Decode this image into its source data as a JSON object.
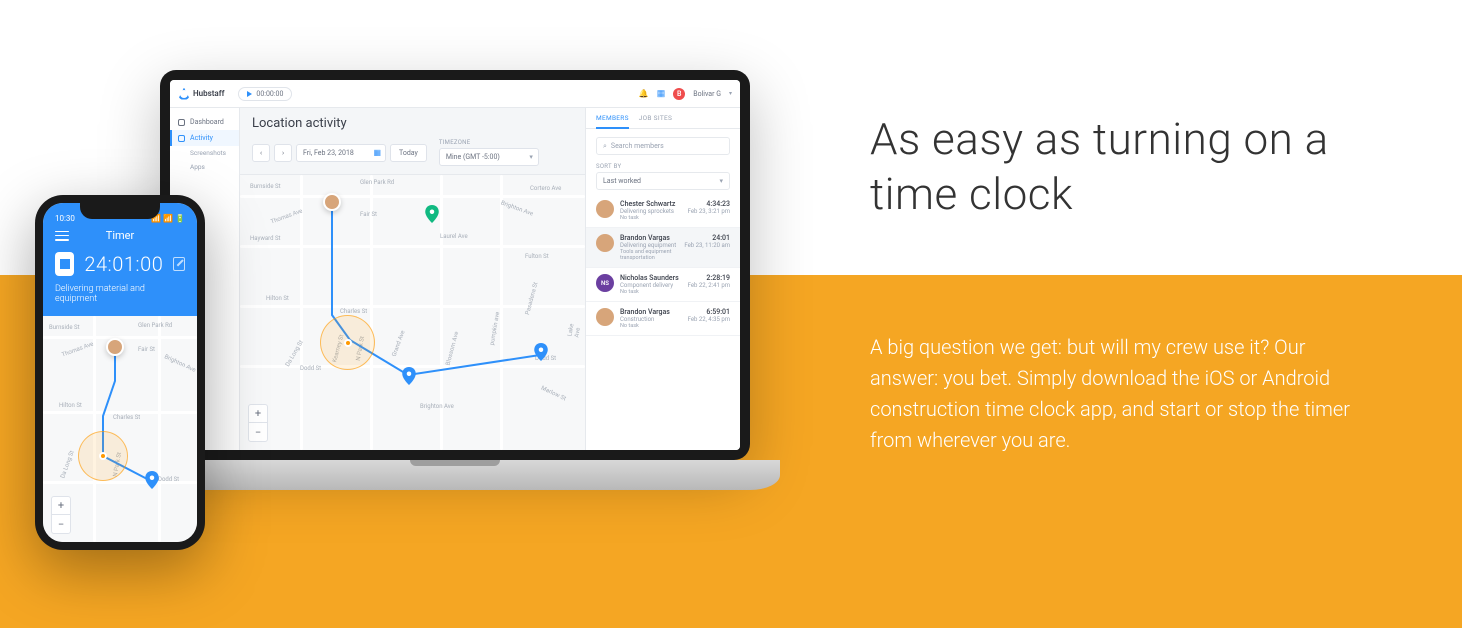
{
  "marketing": {
    "headline": "As easy as turning on a time clock",
    "description": "A big question we get: but will my crew use it? Our answer: you bet. Simply download the iOS or Android construction time clock app, and start or stop the timer from wherever you are."
  },
  "laptop": {
    "brand": "Hubstaff",
    "timer_pill": "00:00:00",
    "user_name": "Bolivar G",
    "user_initial": "B",
    "sidebar": {
      "dashboard": "Dashboard",
      "activity": "Activity",
      "screenshots": "Screenshots",
      "apps": "Apps"
    },
    "page_title": "Location activity",
    "date": "Fri, Feb 23, 2018",
    "today": "Today",
    "timezone_label": "TIMEZONE",
    "timezone_value": "Mine (GMT -5:00)",
    "panel": {
      "tab_members": "MEMBERS",
      "tab_jobsites": "JOB SITES",
      "search_placeholder": "Search members",
      "sortby_label": "SORT BY",
      "sortby_value": "Last worked",
      "members": [
        {
          "name": "Chester Schwartz",
          "task": "Delivering sprockets",
          "task2": "No task",
          "time": "4:34:23",
          "when": "Feb 23, 3:21 pm"
        },
        {
          "name": "Brandon Vargas",
          "task": "Delivering equipment",
          "task2": "Tools and equipment transportation",
          "time": "24:01",
          "when": "Feb 23, 11:20 am"
        },
        {
          "name": "Nicholas Saunders",
          "task": "Component delivery",
          "task2": "No task",
          "time": "2:28:19",
          "when": "Feb 22, 2:41 pm",
          "initial": "NS"
        },
        {
          "name": "Brandon Vargas",
          "task": "Construction",
          "task2": "No task",
          "time": "6:59:01",
          "when": "Feb 22, 4:35 pm"
        }
      ]
    },
    "streets": {
      "burnside": "Burnside St",
      "glenpark": "Glen Park Rd",
      "thomas": "Thomas Ave",
      "fair": "Fair St",
      "brighton": "Brighton Ave",
      "hayward": "Hayward St",
      "laurel": "Laurel Ave",
      "cortero": "Cortero Ave",
      "fulton": "Fulton St",
      "hilton": "Hilton St",
      "charles": "Charles St",
      "dodd": "Dodd St",
      "dodd2": "Dodd St",
      "kearney": "Kearney St",
      "npark": "N Park St",
      "grand": "Grand Ave",
      "blossom": "Blossom Ave",
      "pumpkin": "pumpkin ave",
      "lake": "Lake Ave",
      "brighton2": "Brighton Ave",
      "pasadena": "Pasadena St",
      "marlow": "Marlow St",
      "dalong": "Da Long St"
    }
  },
  "phone": {
    "status_time": "10:30",
    "title": "Timer",
    "timer": "24:01:00",
    "task": "Delivering material and equipment",
    "streets": {
      "burnside": "Burnside St",
      "glenpark": "Glen Park Rd",
      "thomas": "Thomas Ave",
      "fair": "Fair St",
      "brighton": "Brighton Ave",
      "hilton": "Hilton St",
      "charles": "Charles St",
      "dodd": "Dodd St",
      "npark": "N Park St",
      "dalong": "Da Long St"
    }
  }
}
